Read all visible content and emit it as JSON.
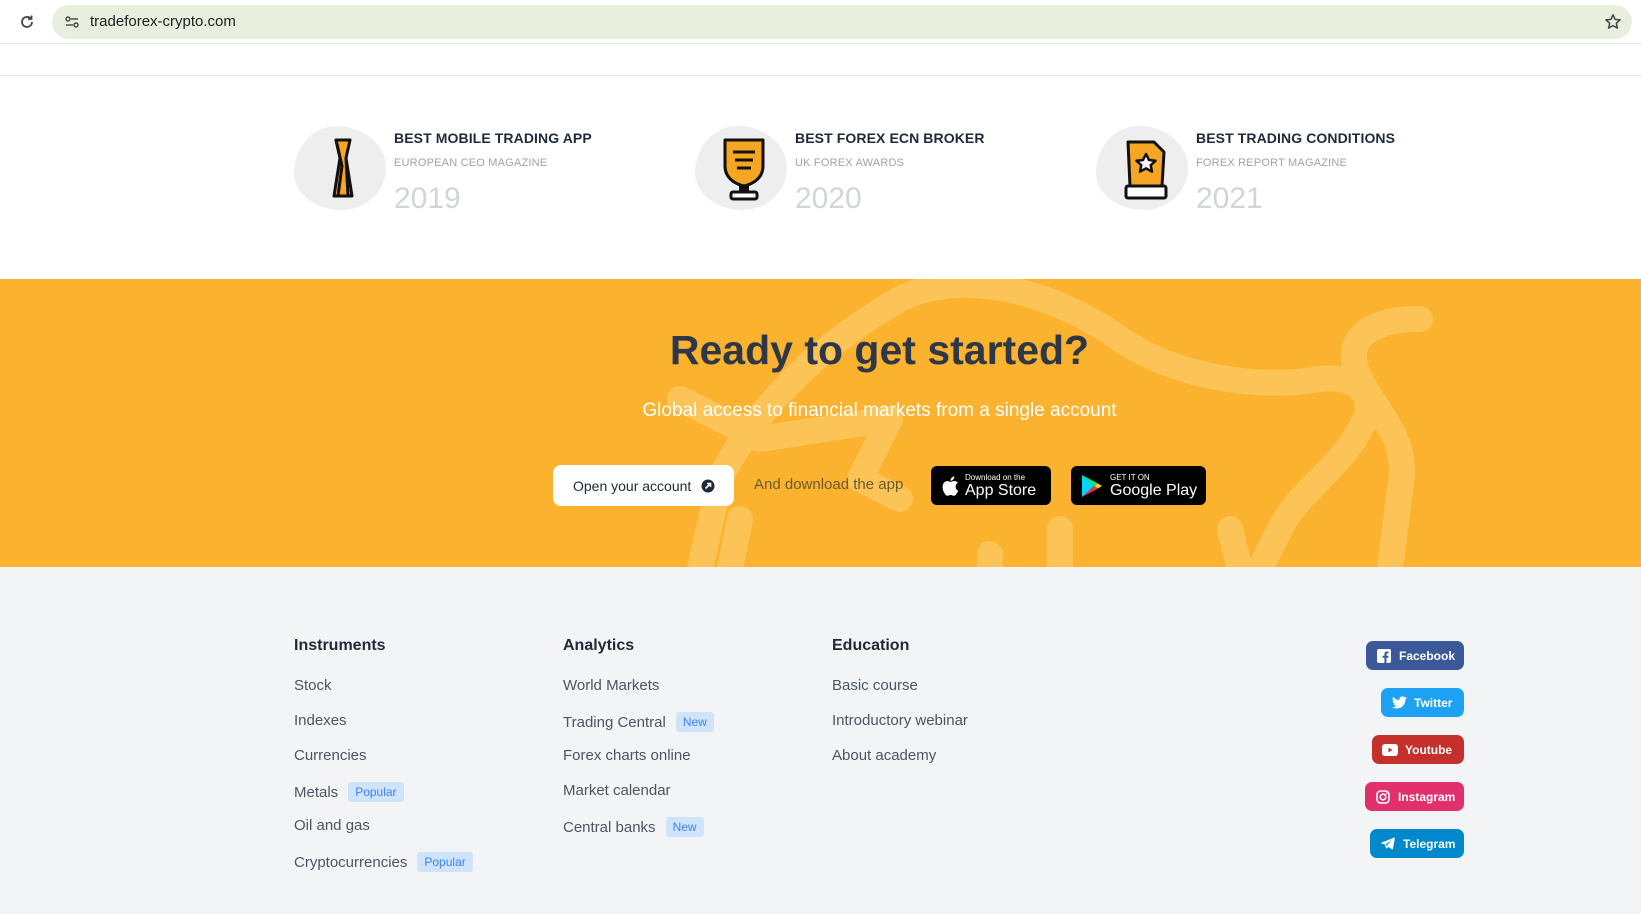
{
  "browser": {
    "url": "tradeforex-crypto.com",
    "reload_icon": "reload-icon",
    "site_info_icon": "site-settings-icon",
    "bookmark_icon": "star-icon"
  },
  "awards": [
    {
      "title": "BEST MOBILE TRADING APP",
      "source": "EUROPEAN CEO MAGAZINE",
      "year": "2019",
      "icon": "trophy-column-icon"
    },
    {
      "title": "BEST FOREX ECN BROKER",
      "source": "UK FOREX AWARDS",
      "year": "2020",
      "icon": "trophy-shield-icon"
    },
    {
      "title": "BEST TRADING CONDITIONS",
      "source": "FOREX REPORT MAGAZINE",
      "year": "2021",
      "icon": "trophy-star-icon"
    }
  ],
  "cta": {
    "title": "Ready to get started?",
    "subtitle": "Global access to financial markets from a single account",
    "open_account": "Open your account",
    "download_text": "And download the app",
    "app_store_small": "Download on the",
    "app_store_big": "App Store",
    "google_play_small": "GET IT ON",
    "google_play_big": "Google Play",
    "bg_color": "#fbb32f"
  },
  "footer": {
    "instruments": {
      "title": "Instruments",
      "links": [
        {
          "label": "Stock",
          "badge": ""
        },
        {
          "label": "Indexes",
          "badge": ""
        },
        {
          "label": "Currencies",
          "badge": ""
        },
        {
          "label": "Metals",
          "badge": "Popular"
        },
        {
          "label": "Oil and gas",
          "badge": ""
        },
        {
          "label": "Cryptocurrencies",
          "badge": "Popular"
        }
      ]
    },
    "analytics": {
      "title": "Analytics",
      "links": [
        {
          "label": "World Markets",
          "badge": ""
        },
        {
          "label": "Trading Central",
          "badge": "New"
        },
        {
          "label": "Forex charts online",
          "badge": ""
        },
        {
          "label": "Market calendar",
          "badge": ""
        },
        {
          "label": "Central banks",
          "badge": "New"
        }
      ]
    },
    "education": {
      "title": "Education",
      "links": [
        {
          "label": "Basic course",
          "badge": ""
        },
        {
          "label": "Introductory webinar",
          "badge": ""
        },
        {
          "label": "About academy",
          "badge": ""
        }
      ]
    },
    "social": [
      {
        "label": "Facebook",
        "color": "#3b5998",
        "icon": "facebook-icon"
      },
      {
        "label": "Twitter",
        "color": "#1da1f2",
        "icon": "twitter-icon"
      },
      {
        "label": "Youtube",
        "color": "#c4302b",
        "icon": "youtube-icon"
      },
      {
        "label": "Instagram",
        "color": "#e1306c",
        "icon": "instagram-icon"
      },
      {
        "label": "Telegram",
        "color": "#0088cc",
        "icon": "telegram-icon"
      }
    ]
  }
}
